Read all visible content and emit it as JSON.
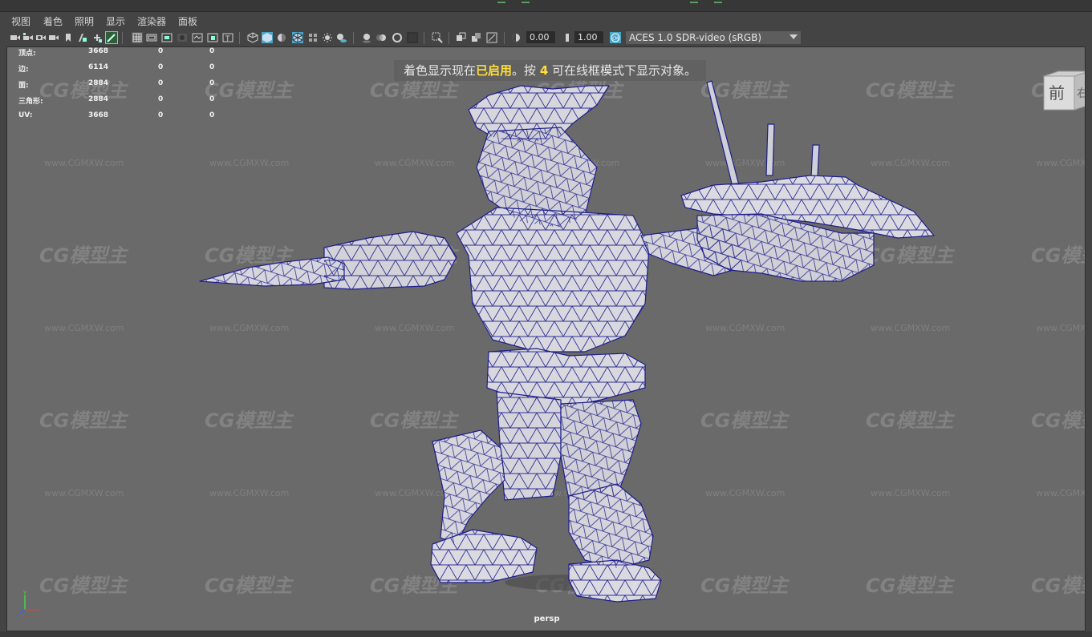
{
  "menu": {
    "items": [
      "视图",
      "着色",
      "照明",
      "显示",
      "渲染器",
      "面板"
    ]
  },
  "toolbar": {
    "exposure_value": "0.00",
    "gamma_value": "1.00",
    "color_space": "ACES 1.0 SDR-video (sRGB)",
    "icons": [
      "select-camera-icon",
      "camera-attributes-icon",
      "bookmark-icon",
      "image-plane-icon",
      "grid-icon",
      "film-gate-icon",
      "resolution-gate-icon",
      "gate-mask-icon",
      "field-chart-icon",
      "safe-action-icon",
      "safe-title-icon",
      "wireframe-icon",
      "smooth-shade-icon",
      "default-material-icon",
      "textured-icon",
      "wireframe-on-shaded-icon",
      "xray-icon",
      "use-all-lights-icon",
      "shadows-icon",
      "screen-space-ao-icon",
      "motion-blur-icon",
      "multisample-aa-icon",
      "depth-of-field-icon",
      "isolate-select-icon",
      "xray-joints-icon",
      "backface-culling-icon",
      "exposure-icon",
      "gamma-icon",
      "color-management-icon"
    ]
  },
  "hud": {
    "rows": [
      {
        "label": "顶点:",
        "v1": "3668",
        "v2": "0",
        "v3": "0"
      },
      {
        "label": "边:",
        "v1": "6114",
        "v2": "0",
        "v3": "0"
      },
      {
        "label": "面:",
        "v1": "2884",
        "v2": "0",
        "v3": "0"
      },
      {
        "label": "三角形:",
        "v1": "2884",
        "v2": "0",
        "v3": "0"
      },
      {
        "label": "UV:",
        "v1": "3668",
        "v2": "0",
        "v3": "0"
      }
    ]
  },
  "notice": {
    "prefix": "着色显示现在",
    "highlight": "已启用",
    "middle": "。按 ",
    "key": "4",
    "suffix": " 可在线框模式下显示对象。"
  },
  "viewcube": {
    "face": "前",
    "side": "右"
  },
  "camera_label": "persp",
  "watermark": {
    "logo": "CG模型主",
    "url": "www.CGMXW.com"
  },
  "colors": {
    "wire": "#1e1e8c",
    "highlight": "#ffde3a",
    "selected_icon": "#5ab0c8"
  }
}
